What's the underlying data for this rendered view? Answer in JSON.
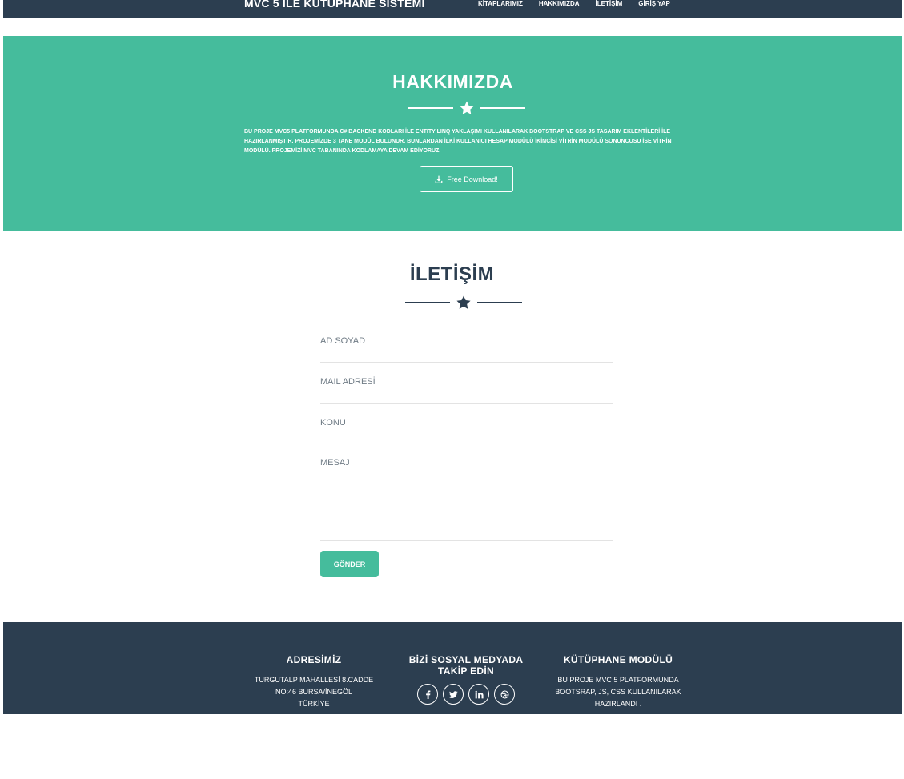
{
  "nav": {
    "brand": "MVC 5 İLE KÜTÜPHANE SİSTEMİ",
    "links": [
      "KİTAPLARIMIZ",
      "HAKKIMIZDA",
      "İLETİŞİM",
      "GİRİŞ YAP"
    ]
  },
  "about": {
    "title": "HAKKIMIZDA",
    "text": "BU PROJE MVC5 PLATFORMUNDA C# BACKEND KODLARI İLE ENTITY LINQ YAKLAŞIMI KULLANILARAK BOOTSTRAP VE CSS JS TASARIM EKLENTİLERİ İLE HAZIRLANMIŞTIR. PROJEMİZDE 3 TANE MODÜL BULUNUR. BUNLARDAN İLKİ KULLANICI HESAP MODÜLÜ İKİNCİSİ VİTRİN MODÜLÜ SONUNCUSU İSE VİTRİN MODÜLÜ. PROJEMİZİ MVC TABANINDA KODLAMAYA DEVAM EDİYORUZ.",
    "button_label": "Free Download!",
    "button_icon": "download-icon"
  },
  "contact": {
    "title": "İLETİŞİM",
    "fields": {
      "name_placeholder": "AD SOYAD",
      "email_placeholder": "MAIL ADRESİ",
      "subject_placeholder": "KONU",
      "message_placeholder": "MESAJ"
    },
    "submit_label": "GÖNDER"
  },
  "footer": {
    "address_title": "ADRESİMİZ",
    "address_lines": [
      "TURGUTALP MAHALLESİ 8.CADDE",
      "NO:46 BURSA/İNEGÖL",
      "TÜRKİYE"
    ],
    "social_title_lines": [
      "BİZİ SOSYAL MEDYADA",
      "TAKİP EDİN"
    ],
    "social_icons": [
      "facebook-icon",
      "twitter-icon",
      "linkedin-icon",
      "dribbble-icon"
    ],
    "module_title": "KÜTÜPHANE MODÜLÜ",
    "module_lines": [
      "BU PROJE MVC 5 PLATFORMUNDA",
      "BOOTSRAP, JS, CSS KULLANILARAK",
      "HAZIRLANDI ."
    ]
  },
  "colors": {
    "navy": "#2c3e50",
    "teal": "#45bc9c",
    "white": "#ffffff"
  }
}
